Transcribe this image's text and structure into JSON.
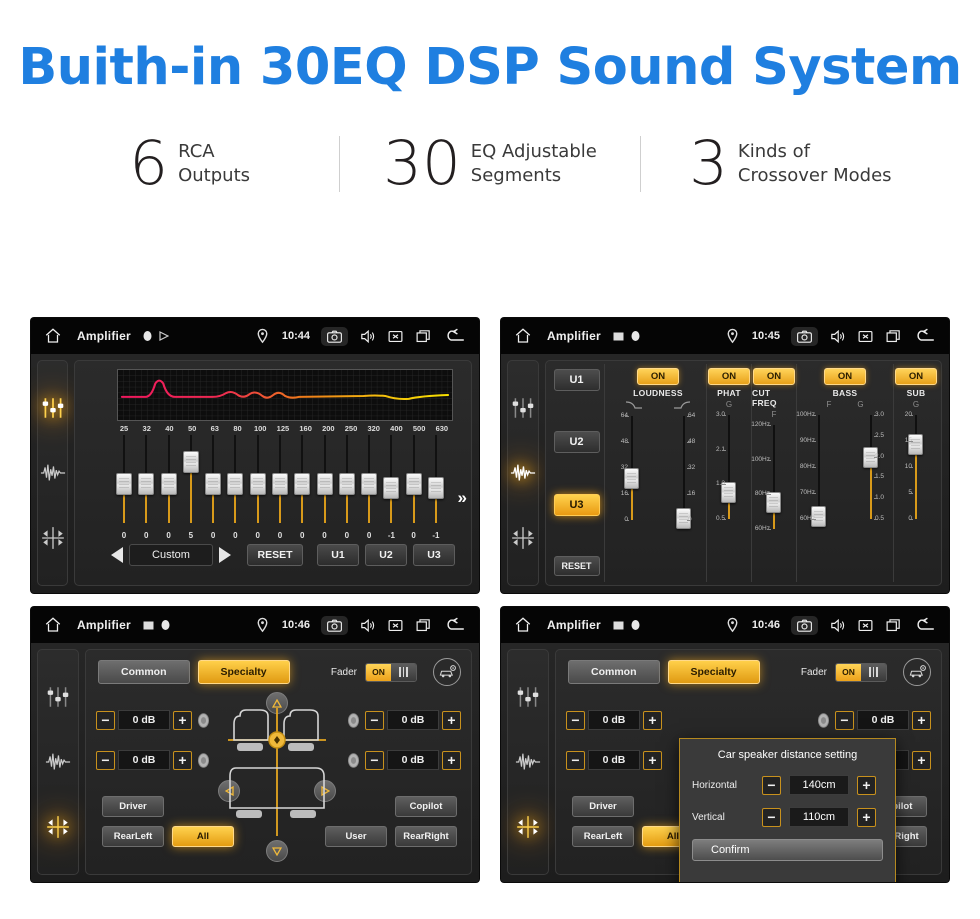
{
  "hero": {
    "title": "Buith-in 30EQ DSP Sound System"
  },
  "stats": [
    {
      "number": "6",
      "text": "RCA\nOutputs"
    },
    {
      "number": "30",
      "text": "EQ Adjustable\nSegments"
    },
    {
      "number": "3",
      "text": "Kinds of\nCrossover Modes"
    }
  ],
  "colors": {
    "title_blue": "#1f7fe0",
    "accent_amber": "#e8a11a",
    "panel_bg": "#1b1b1b"
  },
  "statusbar": {
    "title": "Amplifier",
    "icons": {
      "home": "home-icon",
      "location": "location-pin-icon",
      "camera": "camera-icon",
      "volume": "speaker-icon",
      "mute": "mute-box-icon",
      "recents": "recent-apps-icon",
      "back": "back-arrow-icon"
    }
  },
  "rail": {
    "items": [
      {
        "icon": "equalizer-sliders-icon"
      },
      {
        "icon": "waveform-icon"
      },
      {
        "icon": "balance-fader-icon"
      }
    ]
  },
  "panel1": {
    "time": "10:44",
    "active_rail": 0,
    "graph": {
      "label": "eq-response-curve"
    },
    "frequencies": [
      "25",
      "32",
      "40",
      "50",
      "63",
      "80",
      "100",
      "125",
      "160",
      "200",
      "250",
      "320",
      "400",
      "500",
      "630"
    ],
    "values": [
      "0",
      "0",
      "0",
      "5",
      "0",
      "0",
      "0",
      "0",
      "0",
      "0",
      "0",
      "0",
      "-1",
      "0",
      "-1"
    ],
    "preset": "Custom",
    "prev_label": "◀",
    "next_label": "▶",
    "reset_label": "RESET",
    "user_buttons": [
      "U1",
      "U2",
      "U3"
    ],
    "more_label": "»"
  },
  "panel2": {
    "time": "10:45",
    "active_rail": 1,
    "presets": [
      {
        "label": "U1",
        "active": false
      },
      {
        "label": "U2",
        "active": false
      },
      {
        "label": "U3",
        "active": true
      },
      {
        "label": "RESET",
        "active": false
      }
    ],
    "columns": [
      {
        "name": "LOUDNESS",
        "state": "ON",
        "sub": [
          "",
          ""
        ],
        "sliders": [
          {
            "ticks": [
              "64",
              "48",
              "32",
              "16",
              "0"
            ],
            "pos": 40,
            "side": "left"
          },
          {
            "ticks": [
              "64",
              "48",
              "32",
              "16",
              "0"
            ],
            "pos": 2,
            "side": "right"
          }
        ]
      },
      {
        "name": "PHAT",
        "state": "ON",
        "sub": [
          "G"
        ],
        "sliders": [
          {
            "ticks": [
              "3.0",
              "2.1",
              "1.3",
              "0.5"
            ],
            "pos": 26,
            "side": "left"
          }
        ]
      },
      {
        "name": "CUT FREQ",
        "state": "ON",
        "sub": [
          "F"
        ],
        "sliders": [
          {
            "ticks": [
              "120Hz",
              "100Hz",
              "80Hz",
              "60Hz"
            ],
            "pos": 26,
            "side": "left"
          }
        ]
      },
      {
        "name": "BASS",
        "state": "ON",
        "sub": [
          "F",
          "G"
        ],
        "sliders": [
          {
            "ticks": [
              "100Hz",
              "90Hz",
              "80Hz",
              "70Hz",
              "60Hz"
            ],
            "pos": 3,
            "side": "left"
          },
          {
            "ticks": [
              "3.0",
              "2.5",
              "2.0",
              "1.5",
              "1.0",
              "0.5"
            ],
            "pos": 60,
            "side": "right"
          }
        ]
      },
      {
        "name": "SUB",
        "state": "ON",
        "sub": [
          "G"
        ],
        "sliders": [
          {
            "ticks": [
              "20",
              "15",
              "10",
              "5",
              "0"
            ],
            "pos": 72,
            "side": "left"
          }
        ]
      }
    ]
  },
  "panel3": {
    "time": "10:46",
    "active_rail": 2,
    "tabs": [
      {
        "label": "Common",
        "active": false
      },
      {
        "label": "Specialty",
        "active": true
      }
    ],
    "fader_label": "Fader",
    "fader_state": "ON",
    "car_setting_icon": "car-speaker-setting-icon",
    "db_controls": [
      {
        "value": "0 dB",
        "minus": "−",
        "plus": "+",
        "position": "top-left"
      },
      {
        "value": "0 dB",
        "minus": "−",
        "plus": "+",
        "position": "bottom-left"
      },
      {
        "value": "0 dB",
        "minus": "−",
        "plus": "+",
        "position": "top-right"
      },
      {
        "value": "0 dB",
        "minus": "−",
        "plus": "+",
        "position": "bottom-right"
      }
    ],
    "seat_buttons": [
      {
        "label": "Driver",
        "active": false
      },
      {
        "label": "RearLeft",
        "active": false
      },
      {
        "label": "All",
        "active": true
      },
      {
        "label": "User",
        "active": false
      },
      {
        "label": "Copilot",
        "active": false
      },
      {
        "label": "RearRight",
        "active": false
      }
    ]
  },
  "panel4": {
    "time": "10:46",
    "active_rail": 2,
    "modal": {
      "title": "Car speaker distance setting",
      "rows": [
        {
          "label": "Horizontal",
          "value": "140cm",
          "minus": "−",
          "plus": "+"
        },
        {
          "label": "Vertical",
          "value": "110cm",
          "minus": "−",
          "plus": "+"
        }
      ],
      "confirm_label": "Confirm"
    }
  }
}
